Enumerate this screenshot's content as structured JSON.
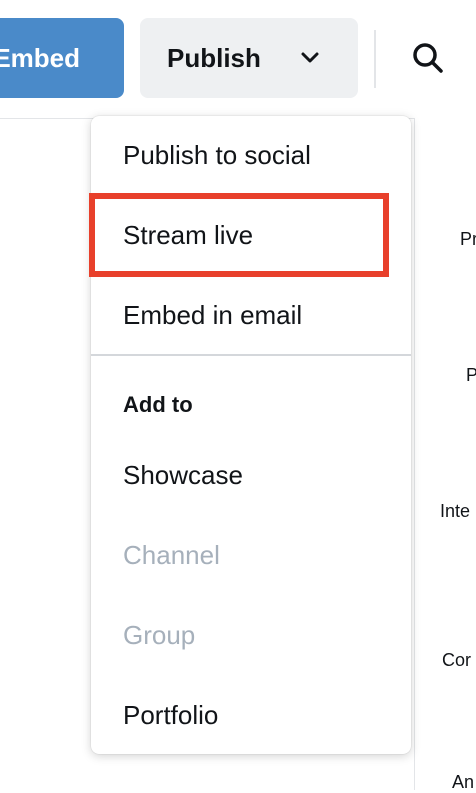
{
  "toolbar": {
    "embed_label": "Embed",
    "publish_label": "Publish",
    "publish_icon": "chevron-down-icon",
    "search_icon": "search-icon"
  },
  "publish_menu": {
    "items_top": [
      {
        "label": "Publish to social",
        "enabled": true
      },
      {
        "label": "Stream live",
        "enabled": true,
        "highlighted": true
      },
      {
        "label": "Embed in email",
        "enabled": true
      }
    ],
    "section_heading": "Add to",
    "items_add_to": [
      {
        "label": "Showcase",
        "enabled": true
      },
      {
        "label": "Channel",
        "enabled": false
      },
      {
        "label": "Group",
        "enabled": false
      },
      {
        "label": "Portfolio",
        "enabled": true
      }
    ]
  },
  "right_column_peek": [
    "Pr",
    "P",
    "Inte",
    "Cor",
    "An"
  ],
  "colors": {
    "embed_button_bg": "#4a8ac9",
    "publish_button_bg": "#eef0f2",
    "highlight_border": "#e8402b",
    "disabled_text": "#a6b0bb"
  }
}
